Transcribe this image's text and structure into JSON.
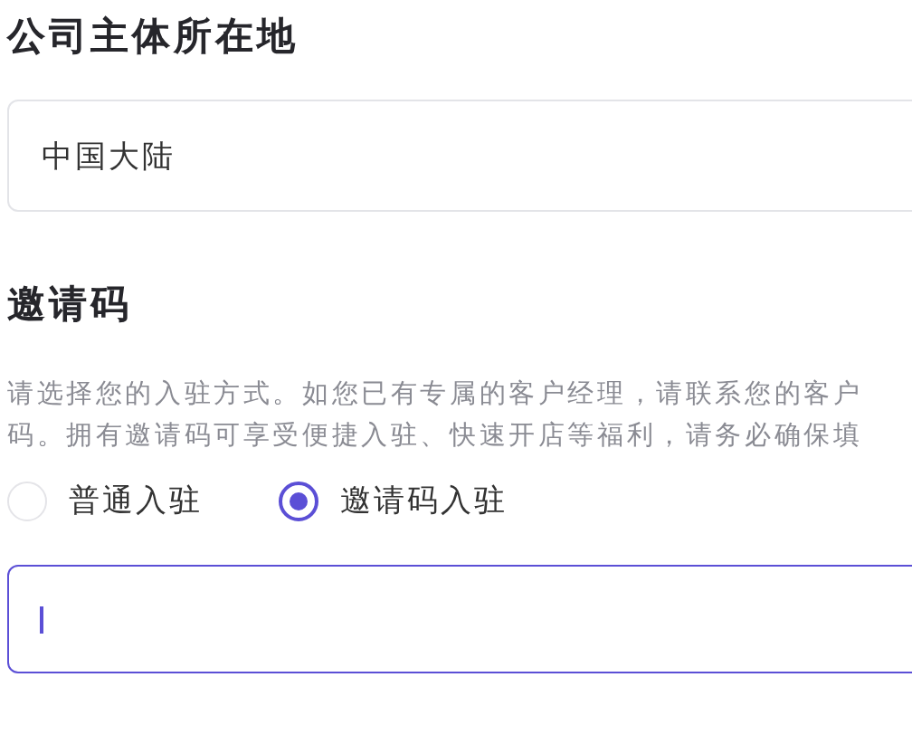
{
  "company_location": {
    "label": "公司主体所在地",
    "value": "中国大陆"
  },
  "invite_code": {
    "heading": "邀请码",
    "description_lines": [
      "请选择您的入驻方式。如您已有专属的客户经理，请联系您的客户",
      "码。拥有邀请码可享受便捷入驻、快速开店等福利，请务必确保填"
    ],
    "options": [
      {
        "label": "普通入驻",
        "selected": false
      },
      {
        "label": "邀请码入驻",
        "selected": true
      }
    ],
    "code_field": {
      "focused": true
    }
  }
}
